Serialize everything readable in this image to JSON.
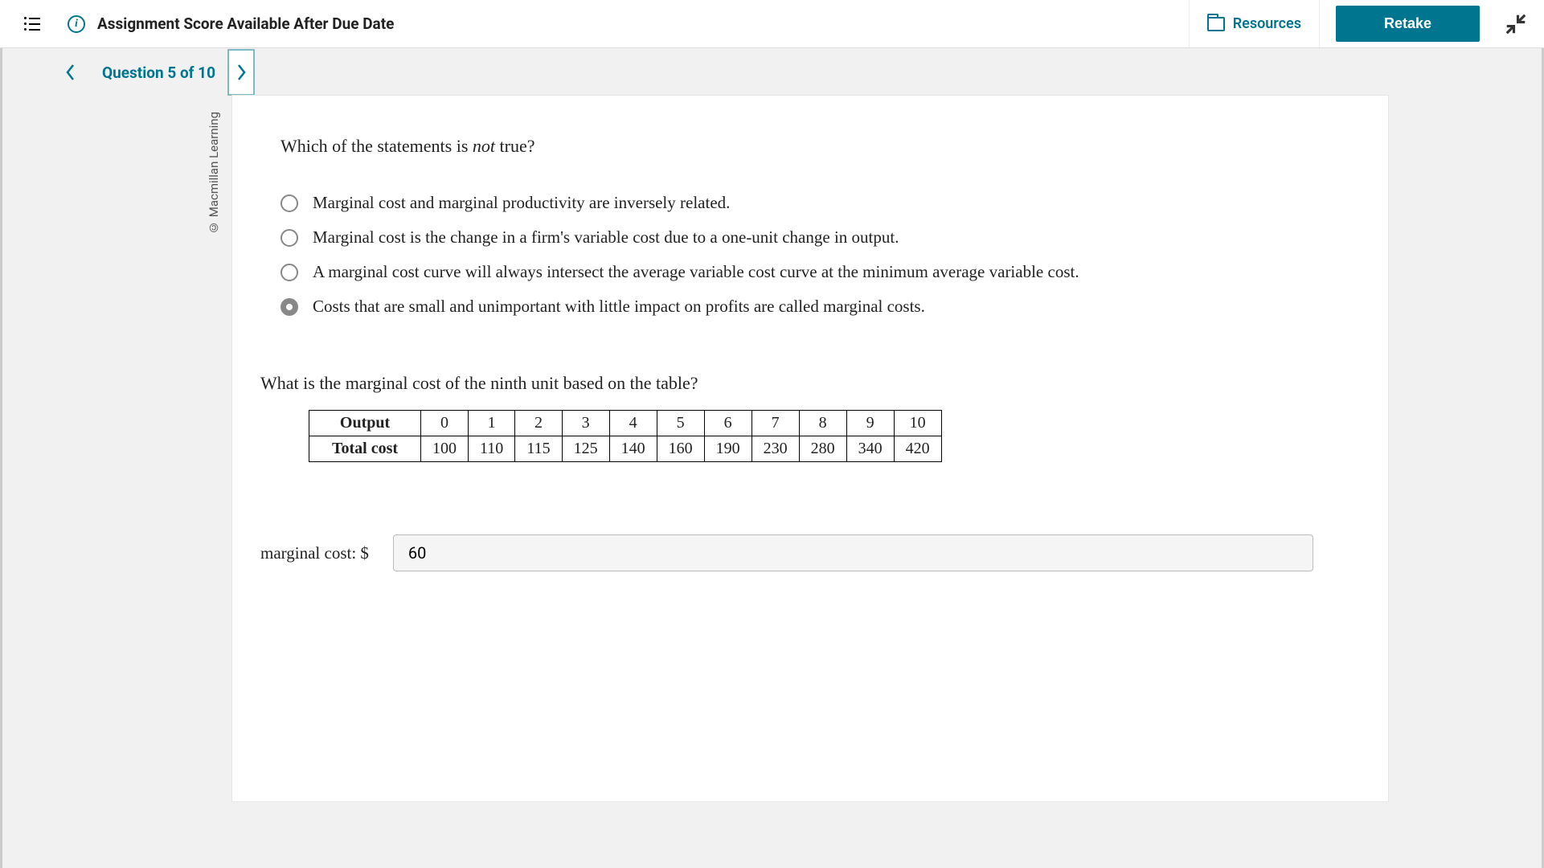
{
  "header": {
    "title": "Assignment Score Available After Due Date",
    "resources_label": "Resources",
    "retake_label": "Retake"
  },
  "nav": {
    "question_label": "Question 5 of 10"
  },
  "copyright": "© Macmillan Learning",
  "question1": {
    "stem_before": "Which of the statements is ",
    "stem_em": "not",
    "stem_after": " true?",
    "choices": [
      {
        "text": "Marginal cost and marginal productivity are inversely related.",
        "selected": false
      },
      {
        "text": "Marginal cost is the change in a firm's variable cost due to a one-unit change in output.",
        "selected": false
      },
      {
        "text": "A marginal cost curve will always intersect the average variable cost curve at the minimum average variable cost.",
        "selected": false
      },
      {
        "text": "Costs that are small and unimportant with little impact on profits are called marginal costs.",
        "selected": true
      }
    ]
  },
  "question2": {
    "stem": "What is the marginal cost of the ninth unit based on the table?",
    "row1_label": "Output",
    "row2_label": "Total cost",
    "output": [
      "0",
      "1",
      "2",
      "3",
      "4",
      "5",
      "6",
      "7",
      "8",
      "9",
      "10"
    ],
    "total_cost": [
      "100",
      "110",
      "115",
      "125",
      "140",
      "160",
      "190",
      "230",
      "280",
      "340",
      "420"
    ],
    "answer_label": "marginal cost: $",
    "answer_value": "60"
  }
}
